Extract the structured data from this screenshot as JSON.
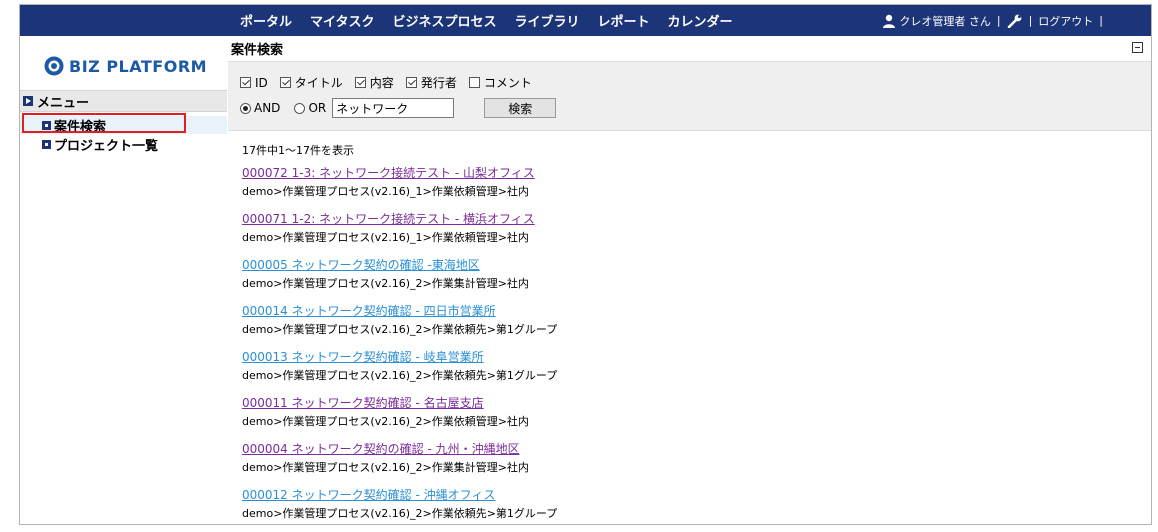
{
  "nav": {
    "items": [
      "ポータル",
      "マイタスク",
      "ビジネスプロセス",
      "ライブラリ",
      "レポート",
      "カレンダー"
    ],
    "user": "クレオ管理者 さん",
    "separator": "|",
    "logout": "ログアウト"
  },
  "logo": {
    "text": "BIZ PLATFORM"
  },
  "sidebar": {
    "header": "メニュー",
    "items": [
      {
        "label": "案件検索"
      },
      {
        "label": "プロジェクト一覧"
      }
    ]
  },
  "main": {
    "title": "案件検索",
    "checkboxes": [
      {
        "label": "ID",
        "checked": true
      },
      {
        "label": "タイトル",
        "checked": true
      },
      {
        "label": "内容",
        "checked": true
      },
      {
        "label": "発行者",
        "checked": true
      },
      {
        "label": "コメント",
        "checked": false
      }
    ],
    "radios": [
      {
        "label": "AND",
        "selected": true
      },
      {
        "label": "OR",
        "selected": false
      }
    ],
    "search_value": "ネットワーク",
    "search_button": "検索",
    "count_text": "17件中1～17件を表示",
    "results": [
      {
        "title": "000072 1-3: ネットワーク接続テスト - 山梨オフィス",
        "path": "demo>作業管理プロセス(v2.16)_1>作業依頼管理>社内",
        "visited": true
      },
      {
        "title": "000071 1-2: ネットワーク接続テスト - 横浜オフィス",
        "path": "demo>作業管理プロセス(v2.16)_1>作業依頼管理>社内",
        "visited": true
      },
      {
        "title": "000005 ネットワーク契約の確認 -東海地区",
        "path": "demo>作業管理プロセス(v2.16)_2>作業集計管理>社内",
        "visited": false
      },
      {
        "title": "000014 ネットワーク契約確認 - 四日市営業所",
        "path": "demo>作業管理プロセス(v2.16)_2>作業依頼先>第1グループ",
        "visited": false
      },
      {
        "title": "000013 ネットワーク契約確認 - 岐阜営業所",
        "path": "demo>作業管理プロセス(v2.16)_2>作業依頼先>第1グループ",
        "visited": false
      },
      {
        "title": "000011 ネットワーク契約確認 - 名古屋支店",
        "path": "demo>作業管理プロセス(v2.16)_2>作業依頼管理>社内",
        "visited": true
      },
      {
        "title": "000004 ネットワーク契約の確認 - 九州・沖縄地区",
        "path": "demo>作業管理プロセス(v2.16)_2>作業集計管理>社内",
        "visited": true
      },
      {
        "title": "000012 ネットワーク契約確認 - 沖縄オフィス",
        "path": "demo>作業管理プロセス(v2.16)_2>作業依頼先>第1グループ",
        "visited": false
      }
    ]
  },
  "colors": {
    "nav_bg": "#1c3478",
    "logo": "#1c5aa6",
    "visited_link": "#7b2c9a",
    "link": "#2a8fd6",
    "highlight": "#e02020"
  }
}
